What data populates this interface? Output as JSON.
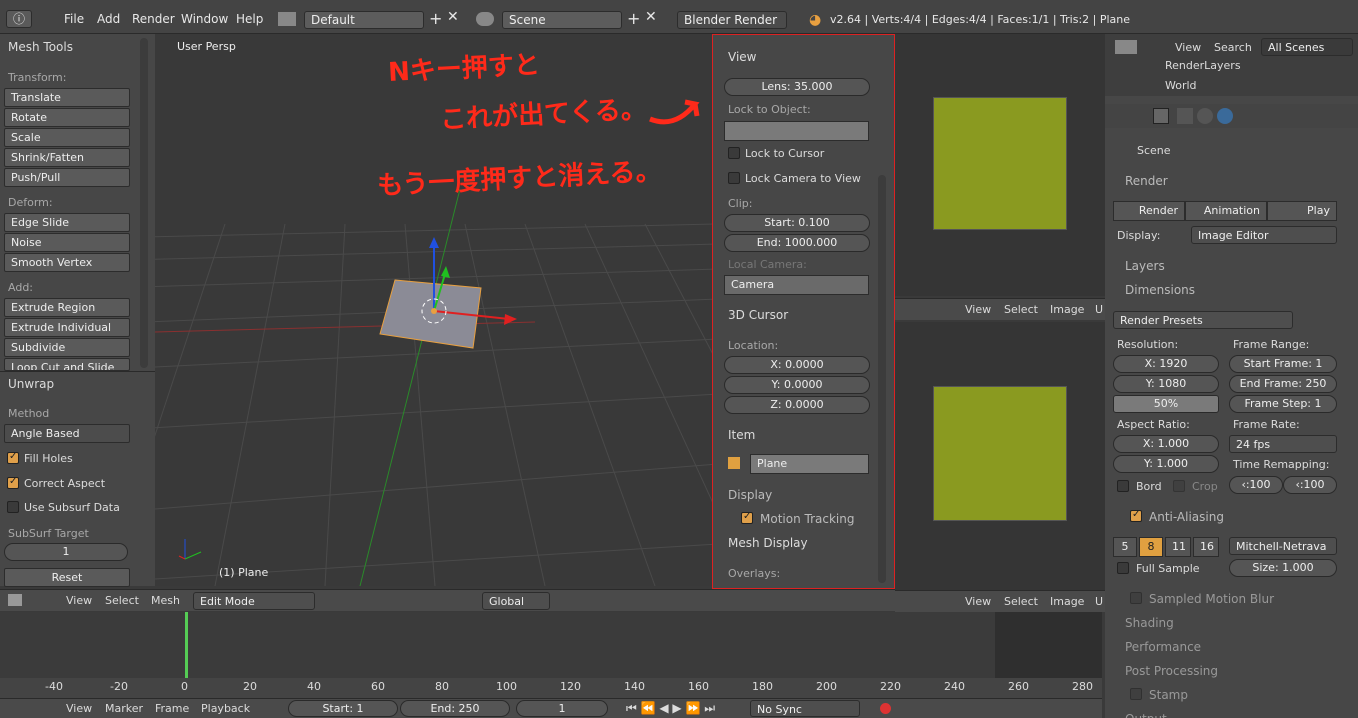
{
  "topbar": {
    "menus": [
      "File",
      "Add",
      "Render",
      "Window",
      "Help"
    ],
    "layout": "Default",
    "scene": "Scene",
    "engine": "Blender Render",
    "stats": "v2.64 | Verts:4/4 | Edges:4/4 | Faces:1/1 | Tris:2 | Plane"
  },
  "tools": {
    "title": "Mesh Tools",
    "transform_label": "Transform:",
    "transform": [
      "Translate",
      "Rotate",
      "Scale",
      "Shrink/Fatten",
      "Push/Pull"
    ],
    "deform_label": "Deform:",
    "deform": [
      "Edge Slide",
      "Noise",
      "Smooth Vertex"
    ],
    "add_label": "Add:",
    "add": [
      "Extrude Region",
      "Extrude Individual",
      "Subdivide",
      "Loop Cut and Slide"
    ]
  },
  "unwrap": {
    "title": "Unwrap",
    "method_label": "Method",
    "method": "Angle Based",
    "fill_holes": "Fill Holes",
    "correct_aspect": "Correct Aspect",
    "use_subsurf": "Use Subsurf Data",
    "subsurf_label": "SubSurf Target",
    "subsurf_value": "1",
    "reset": "Reset"
  },
  "viewport": {
    "label": "User Persp",
    "object": "(1) Plane",
    "annotation": [
      "Nキー押すと",
      "これが出てくる。",
      "もう一度押すと消える。"
    ]
  },
  "npanel": {
    "view_title": "View",
    "lens": "Lens: 35.000",
    "lock_obj": "Lock to Object:",
    "lock_cursor": "Lock to Cursor",
    "lock_cam": "Lock Camera to View",
    "clip": "Clip:",
    "start": "Start: 0.100",
    "end": "End: 1000.000",
    "local_cam": "Local Camera:",
    "camera": "Camera",
    "cursor_title": "3D Cursor",
    "location": "Location:",
    "x": "X: 0.0000",
    "y": "Y: 0.0000",
    "z": "Z: 0.0000",
    "item_title": "Item",
    "item_name": "Plane",
    "display": "Display",
    "motion": "Motion Tracking",
    "mesh_display": "Mesh Display",
    "overlays": "Overlays:"
  },
  "vpheader": {
    "menus": [
      "View",
      "Select",
      "Mesh"
    ],
    "mode": "Edit Mode",
    "orient": "Global"
  },
  "uvheader": {
    "menus": [
      "View",
      "Select",
      "Image"
    ],
    "u": "U"
  },
  "timeline": {
    "ticks": [
      "-40",
      "-20",
      "0",
      "20",
      "40",
      "60",
      "80",
      "100",
      "120",
      "140",
      "160",
      "180",
      "200",
      "220",
      "240",
      "260",
      "280"
    ],
    "menus": [
      "View",
      "Marker",
      "Frame",
      "Playback"
    ],
    "start": "Start: 1",
    "end": "End: 250",
    "frame": "1",
    "sync": "No Sync"
  },
  "outliner": {
    "menus": [
      "View",
      "Search"
    ],
    "scenes": "All Scenes",
    "items": [
      "RenderLayers",
      "World"
    ]
  },
  "props": {
    "scene": "Scene",
    "render_title": "Render",
    "render_btn": "Render",
    "anim_btn": "Animation",
    "play_btn": "Play",
    "display_label": "Display:",
    "display_value": "Image Editor",
    "layers": "Layers",
    "dimensions": "Dimensions",
    "presets": "Render Presets",
    "resolution": "Resolution:",
    "resx": "X: 1920",
    "resy": "Y: 1080",
    "pct": "50%",
    "frame_range": "Frame Range:",
    "fstart": "Start Frame: 1",
    "fend": "End Frame: 250",
    "fstep": "Frame Step: 1",
    "aspect": "Aspect Ratio:",
    "ax": "X: 1.000",
    "ay": "Y: 1.000",
    "frate": "Frame Rate:",
    "fps": "24 fps",
    "remap": "Time Remapping:",
    "r1": "‹:100",
    "r2": "‹:100",
    "bord": "Bord",
    "crop": "Crop",
    "aa": "Anti-Aliasing",
    "aa_vals": [
      "5",
      "8",
      "11",
      "16"
    ],
    "filter": "Mitchell-Netrava",
    "full": "Full Sample",
    "size": "Size: 1.000",
    "smb": "Sampled Motion Blur",
    "shading": "Shading",
    "performance": "Performance",
    "post": "Post Processing",
    "stamp": "Stamp",
    "output": "Output"
  }
}
